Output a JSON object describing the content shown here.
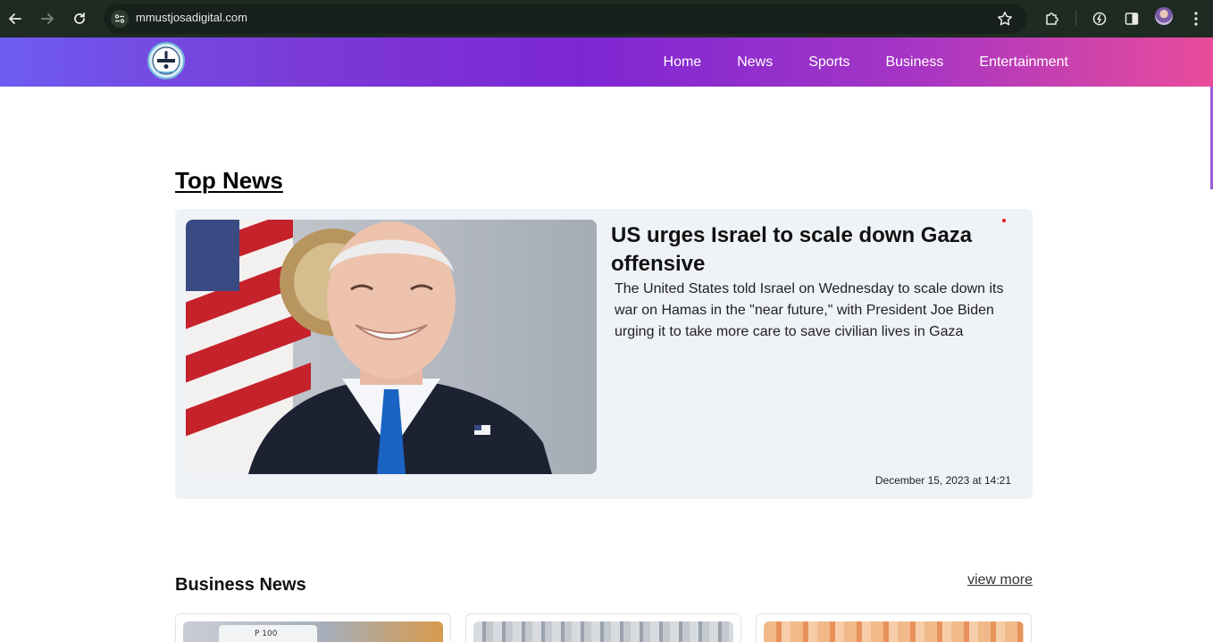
{
  "browser": {
    "url": "mmustjosadigital.com"
  },
  "header": {
    "nav": [
      "Home",
      "News",
      "Sports",
      "Business",
      "Entertainment"
    ]
  },
  "top_news": {
    "section_title": "Top News",
    "headline": "US urges Israel to scale down Gaza offensive",
    "summary": "The United States told Israel on Wednesday to scale down its war on Hamas in the \"near future,\" with President Joe Biden urging it to take more care to save civilian lives in Gaza",
    "timestamp": "December 15, 2023 at 14:21"
  },
  "business_news": {
    "section_title": "Business News",
    "view_more": "view more"
  },
  "colors": {
    "header_start": "#6e5cf0",
    "header_mid": "#7d27d4",
    "header_end": "#e94c9b",
    "card_bg": "#eff2f7",
    "browser_bar": "#1f2a22"
  }
}
